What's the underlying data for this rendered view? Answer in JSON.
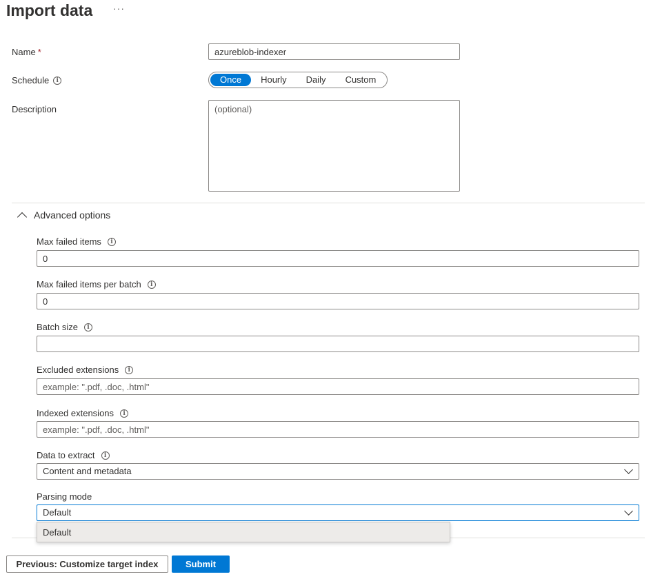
{
  "header": {
    "title": "Import data",
    "more_label": "···"
  },
  "form": {
    "name": {
      "label": "Name",
      "required_mark": "*",
      "value": "azureblob-indexer"
    },
    "schedule": {
      "label": "Schedule",
      "options": [
        "Once",
        "Hourly",
        "Daily",
        "Custom"
      ],
      "selected": "Once"
    },
    "description": {
      "label": "Description",
      "placeholder": "(optional)",
      "value": ""
    }
  },
  "advanced": {
    "header_label": "Advanced options",
    "expanded": true,
    "max_failed_items": {
      "label": "Max failed items",
      "value": "0"
    },
    "max_failed_items_per_batch": {
      "label": "Max failed items per batch",
      "value": "0"
    },
    "batch_size": {
      "label": "Batch size",
      "value": ""
    },
    "excluded_extensions": {
      "label": "Excluded extensions",
      "placeholder": "example: \".pdf, .doc, .html\"",
      "value": ""
    },
    "indexed_extensions": {
      "label": "Indexed extensions",
      "placeholder": "example: \".pdf, .doc, .html\"",
      "value": ""
    },
    "data_to_extract": {
      "label": "Data to extract",
      "value": "Content and metadata"
    },
    "parsing_mode": {
      "label": "Parsing mode",
      "value": "Default",
      "open": true,
      "options": [
        "Default"
      ]
    }
  },
  "footer": {
    "previous_label": "Previous: Customize target index",
    "submit_label": "Submit"
  },
  "colors": {
    "accent": "#0078d4",
    "required": "#a4262c",
    "border": "#8a8886",
    "text": "#323130"
  },
  "icons": {
    "info": "info-icon",
    "more": "more-icon",
    "collapse": "chevron-up-icon",
    "dropdown": "chevron-down-icon"
  }
}
